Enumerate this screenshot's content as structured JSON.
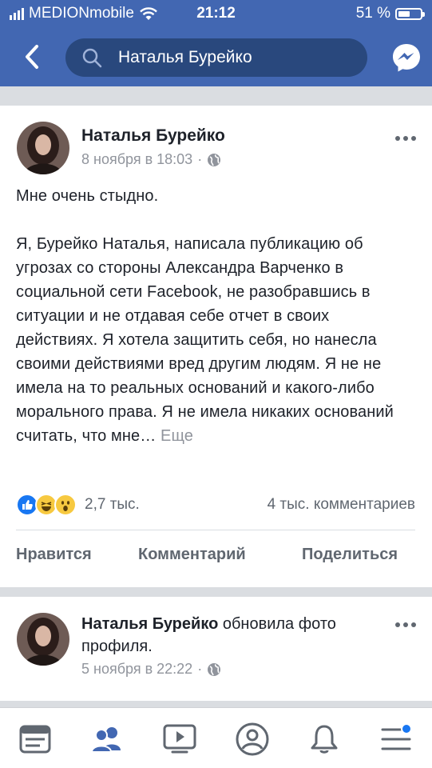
{
  "status_bar": {
    "carrier": "MEDIONmobile",
    "time": "21:12",
    "battery_percent": "51 %",
    "battery_level": 0.51
  },
  "search": {
    "query": "Наталья Бурейко"
  },
  "post1": {
    "author": "Наталья Бурейко",
    "timestamp": "8 ноября в 18:03",
    "audience_icon": "globe-icon",
    "paragraphs": [
      "Мне очень стыдно.",
      "Я, Бурейко Наталья, написала публикацию об угрозах со стороны Александра Варченко в социальной сети Facebook, не разобравшись в ситуации и не отдавая себе отчет в своих действиях. Я хотела защитить себя, но нанесла своими действиями вред другим людям. Я не не имела на то реальных оснований и какого-либо морального права. Я не имела никаких оснований считать, что мне…"
    ],
    "more_label": "Еще",
    "reactions": [
      "like",
      "haha",
      "wow"
    ],
    "reaction_count": "2,7 тыс.",
    "comment_count": "4 тыс. комментариев",
    "actions": {
      "like": "Нравится",
      "comment": "Комментарий",
      "share": "Поделиться"
    }
  },
  "post2": {
    "author": "Наталья Бурейко",
    "action_text": " обновила фото профиля.",
    "timestamp": "5 ноября в 22:22",
    "audience_icon": "globe-icon"
  },
  "bottom_nav": [
    "news-feed-icon",
    "friends-icon",
    "watch-icon",
    "profile-icon",
    "notifications-icon",
    "menu-icon"
  ],
  "colors": {
    "brand": "#4267b2",
    "search_bg": "#29487d",
    "active_tab": "#4267b2",
    "muted": "#90949c"
  }
}
